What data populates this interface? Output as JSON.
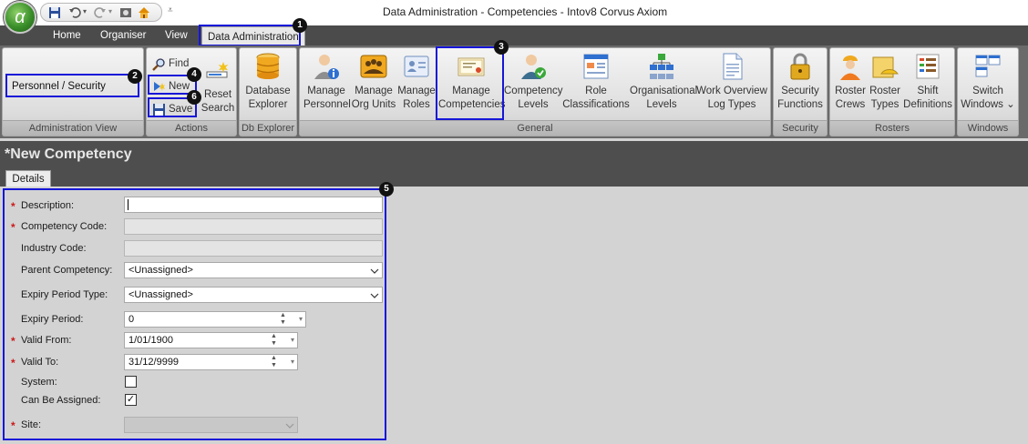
{
  "window": {
    "title": "Data Administration - Competencies - Intov8 Corvus Axiom",
    "orb_glyph": "α"
  },
  "qat_icons": [
    "save-icon",
    "undo-icon",
    "redo-icon",
    "screenshot-icon",
    "home-icon"
  ],
  "tabs": [
    {
      "label": "Home"
    },
    {
      "label": "Organiser"
    },
    {
      "label": "View"
    },
    {
      "label": "Data Administration"
    }
  ],
  "ribbon": {
    "admin_view": {
      "value": "Personnel / Security",
      "group_label": "Administration View"
    },
    "actions": {
      "find": "Find",
      "new": "New",
      "save": "Save",
      "reset_search": [
        "Reset",
        "Search"
      ],
      "group_label": "Actions"
    },
    "db_explorer": {
      "button": [
        "Database",
        "Explorer"
      ],
      "group_label": "Db Explorer"
    },
    "general": {
      "group_label": "General",
      "buttons": [
        {
          "lines": [
            "Manage",
            "Personnel"
          ]
        },
        {
          "lines": [
            "Manage",
            "Org Units"
          ]
        },
        {
          "lines": [
            "Manage",
            "Roles"
          ]
        },
        {
          "lines": [
            "Manage",
            "Competencies"
          ]
        },
        {
          "lines": [
            "Competency",
            "Levels"
          ]
        },
        {
          "lines": [
            "Role",
            "Classifications"
          ]
        },
        {
          "lines": [
            "Organisational",
            "Levels"
          ]
        },
        {
          "lines": [
            "Work Overview",
            "Log Types"
          ]
        }
      ]
    },
    "security": {
      "button": [
        "Security",
        "Functions"
      ],
      "group_label": "Security"
    },
    "rosters": {
      "group_label": "Rosters",
      "buttons": [
        {
          "lines": [
            "Roster",
            "Crews"
          ]
        },
        {
          "lines": [
            "Roster",
            "Types"
          ]
        },
        {
          "lines": [
            "Shift",
            "Definitions"
          ]
        }
      ]
    },
    "windows": {
      "button": [
        "Switch",
        "Windows ⌄"
      ],
      "group_label": "Windows"
    }
  },
  "callouts": [
    "1",
    "2",
    "3",
    "4",
    "5",
    "6"
  ],
  "form": {
    "title": "*New Competency",
    "tab": "Details",
    "fields": {
      "description": {
        "label": "Description:",
        "value": ""
      },
      "competency_code": {
        "label": "Competency Code:",
        "value": ""
      },
      "industry_code": {
        "label": "Industry Code:",
        "value": ""
      },
      "parent_competency": {
        "label": "Parent Competency:",
        "value": "<Unassigned>"
      },
      "expiry_period_type": {
        "label": "Expiry Period Type:",
        "value": "<Unassigned>"
      },
      "expiry_period": {
        "label": "Expiry Period:",
        "value": "0"
      },
      "valid_from": {
        "label": "Valid From:",
        "value": "1/01/1900"
      },
      "valid_to": {
        "label": "Valid To:",
        "value": "31/12/9999"
      },
      "system": {
        "label": "System:",
        "checked": false
      },
      "can_be_assigned": {
        "label": "Can Be Assigned:",
        "checked": true
      },
      "site": {
        "label": "Site:",
        "value": ""
      }
    },
    "required_mark": "*",
    "check_glyph": "✓"
  },
  "colors": {
    "callout": "#1616d8",
    "required": "#cc1a1a",
    "tab_bar": "#4b4b4b"
  }
}
